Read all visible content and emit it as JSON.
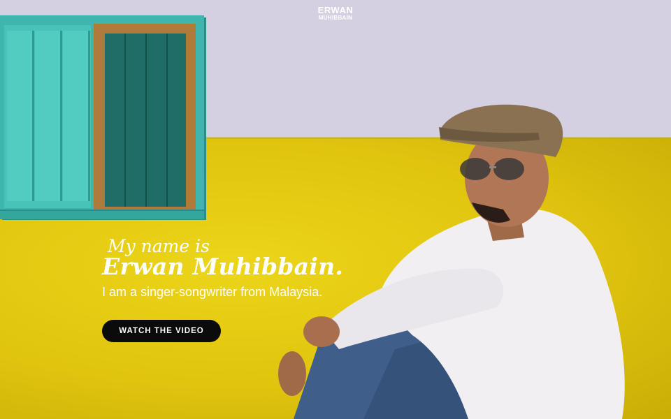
{
  "brand": {
    "logo_line1": "ERWAN",
    "logo_line2": "MUHIBBAIN"
  },
  "hero": {
    "intro": "My name is",
    "name": "Erwan Muhibbain.",
    "tagline": "I am a singer-songwriter from Malaysia.",
    "cta_label": "WATCH THE VIDEO"
  },
  "colors": {
    "wall_upper": "#d4d0e2",
    "wall_lower": "#e0c40e",
    "window_teal": "#3fb6ad",
    "button_bg": "#0b0b0b",
    "text": "#ffffff"
  }
}
